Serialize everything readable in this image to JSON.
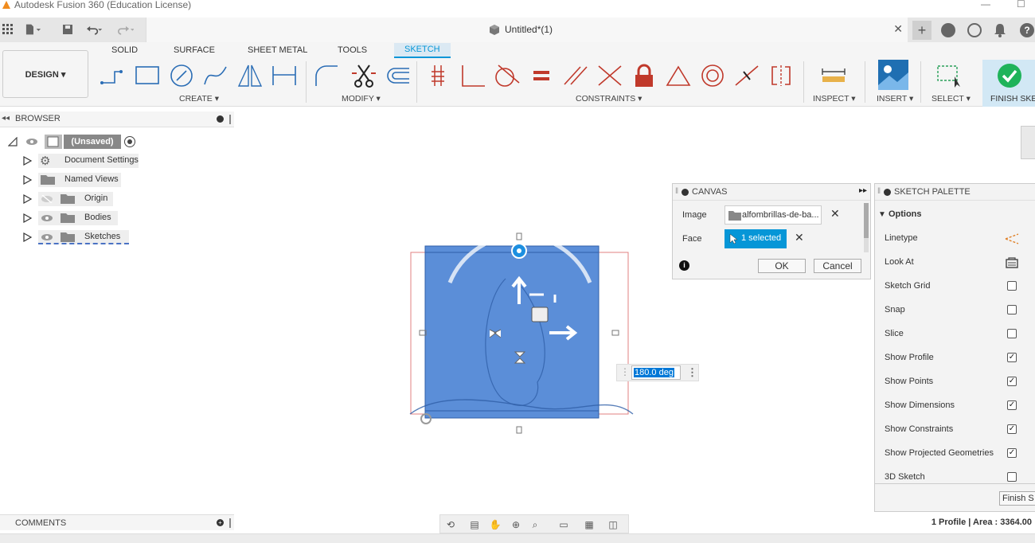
{
  "window": {
    "title": "Autodesk Fusion 360 (Education License)",
    "minimize_glyph": "—",
    "maximize_glyph": "☐"
  },
  "document": {
    "title": "Untitled*(1)",
    "close_glyph": "✕"
  },
  "ribbon": {
    "workspace": "DESIGN ▾",
    "tabs": [
      "SOLID",
      "SURFACE",
      "SHEET METAL",
      "TOOLS",
      "SKETCH"
    ],
    "active_tab": "SKETCH",
    "groups": {
      "create": "CREATE ▾",
      "modify": "MODIFY ▾",
      "constraints": "CONSTRAINTS ▾",
      "inspect": "INSPECT ▾",
      "insert": "INSERT ▾",
      "select": "SELECT ▾",
      "finish": "FINISH SKETCH"
    }
  },
  "browser": {
    "header": "BROWSER",
    "root": "(Unsaved)",
    "items": [
      "Document Settings",
      "Named Views",
      "Origin",
      "Bodies",
      "Sketches"
    ]
  },
  "canvas_panel": {
    "header": "CANVAS",
    "image_label": "Image",
    "image_value": "alfombrillas-de-ba...",
    "face_label": "Face",
    "face_value": "1 selected",
    "ok": "OK",
    "cancel": "Cancel"
  },
  "angle_input": {
    "value": "180.0 deg"
  },
  "sketch_palette": {
    "header": "SKETCH PALETTE",
    "section": "Options",
    "options": [
      {
        "label": "Linetype",
        "kind": "icon"
      },
      {
        "label": "Look At",
        "kind": "icon"
      },
      {
        "label": "Sketch Grid",
        "checked": false
      },
      {
        "label": "Snap",
        "checked": false
      },
      {
        "label": "Slice",
        "checked": false
      },
      {
        "label": "Show Profile",
        "checked": true
      },
      {
        "label": "Show Points",
        "checked": true
      },
      {
        "label": "Show Dimensions",
        "checked": true
      },
      {
        "label": "Show Constraints",
        "checked": true
      },
      {
        "label": "Show Projected Geometries",
        "checked": true
      },
      {
        "label": "3D Sketch",
        "checked": false
      }
    ],
    "finish_button": "Finish S"
  },
  "comments": {
    "header": "COMMENTS"
  },
  "status": {
    "text": "1 Profile | Area : 3364.00"
  },
  "colors": {
    "accent": "#0696d7",
    "canvas_blue": "#5b8ed8",
    "finish_green": "#1fb35a"
  }
}
